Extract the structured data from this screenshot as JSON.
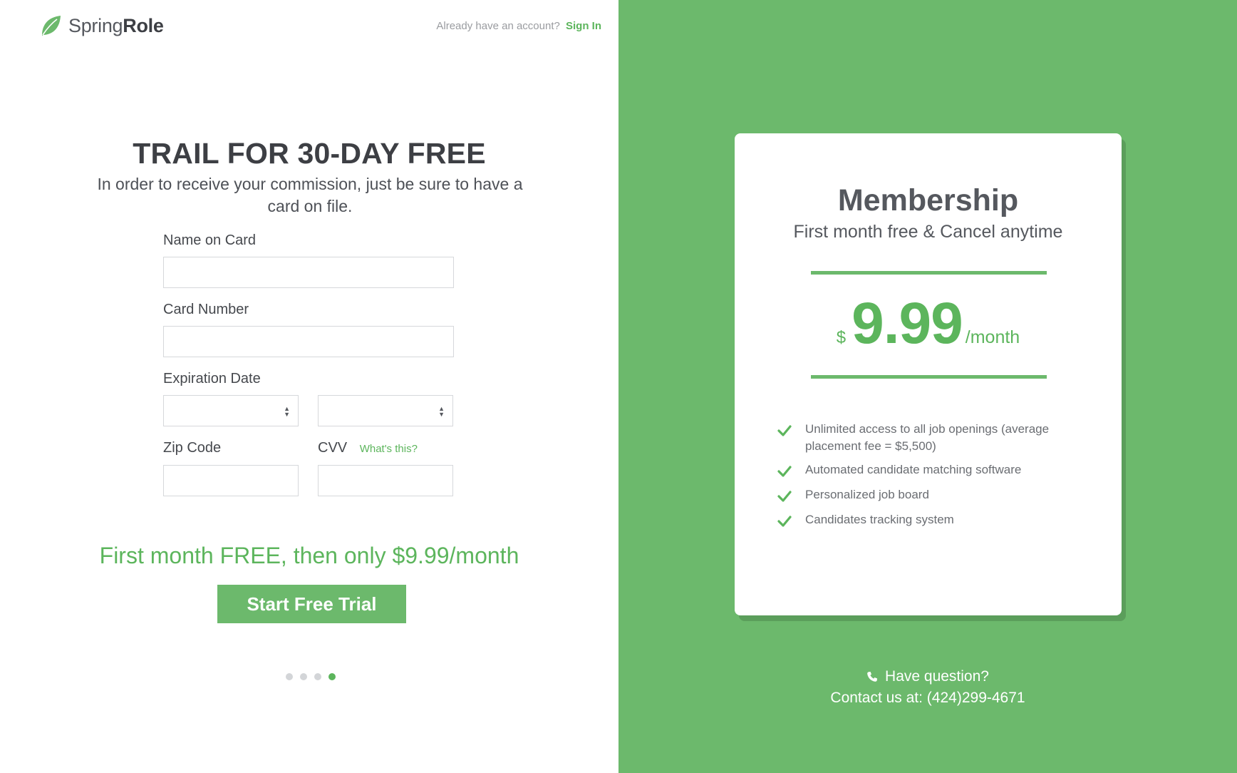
{
  "header": {
    "brand_light": "Spring",
    "brand_bold": "Role",
    "account_prompt": "Already have an account?",
    "signin_label": "Sign In"
  },
  "main": {
    "title": "TRAIL FOR 30-DAY FREE",
    "subtitle": "In order to receive your commission, just be sure to have a card on file."
  },
  "form": {
    "name_label": "Name on Card",
    "name_value": "",
    "card_label": "Card Number",
    "card_value": "",
    "expiration_label": "Expiration Date",
    "exp_month_value": "",
    "exp_year_value": "",
    "zip_label": "Zip Code",
    "zip_value": "",
    "cvv_label": "CVV",
    "cvv_help": "What's this?",
    "cvv_value": ""
  },
  "promo": "First month FREE, then only $9.99/month",
  "cta_label": "Start Free Trial",
  "pagination": {
    "total": 4,
    "active_index": 3
  },
  "card": {
    "title": "Membership",
    "subtitle": "First month free & Cancel anytime",
    "currency": "$",
    "amount": "9.99",
    "period": "/month",
    "features": [
      "Unlimited access to all job openings (average placement fee = $5,500)",
      "Automated candidate matching software",
      "Personalized job board",
      "Candidates tracking system"
    ]
  },
  "contact": {
    "question": "Have question?",
    "line": "Contact us at: (424)299-4671"
  },
  "colors": {
    "accent": "#6cb96c",
    "accent_text": "#5cb55c",
    "heading": "#3d3f44"
  },
  "icons": {
    "logo": "leaf-icon",
    "feature": "check-icon",
    "phone": "phone-icon",
    "select": "select-arrows-icon"
  }
}
